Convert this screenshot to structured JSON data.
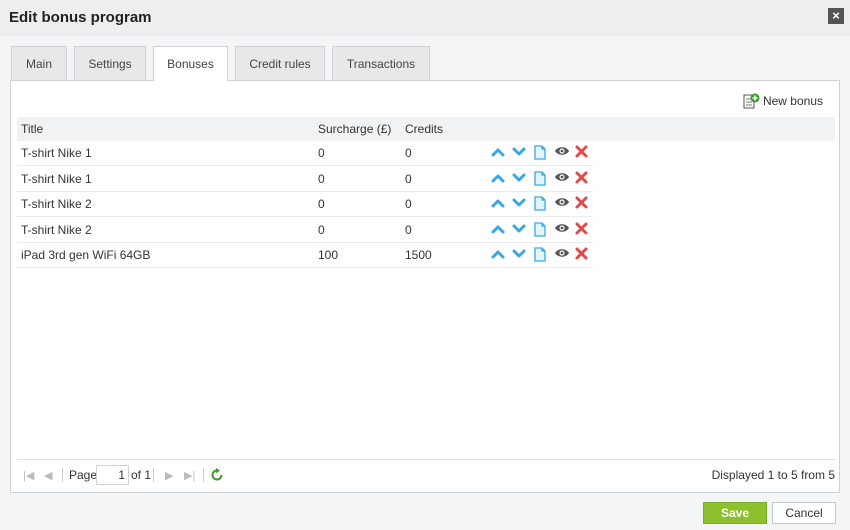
{
  "dialog": {
    "title": "Edit bonus program",
    "close_label": "×"
  },
  "tabs": [
    {
      "label": "Main"
    },
    {
      "label": "Settings"
    },
    {
      "label": "Bonuses",
      "active": true
    },
    {
      "label": "Credit rules"
    },
    {
      "label": "Transactions"
    }
  ],
  "toolbar": {
    "new_bonus_label": "New bonus"
  },
  "grid": {
    "columns": {
      "title": "Title",
      "surcharge": "Surcharge (£)",
      "credits": "Credits"
    },
    "rows": [
      {
        "title": "T-shirt Nike 1",
        "surcharge": "0",
        "credits": "0"
      },
      {
        "title": "T-shirt Nike 1",
        "surcharge": "0",
        "credits": "0"
      },
      {
        "title": "T-shirt Nike 2",
        "surcharge": "0",
        "credits": "0"
      },
      {
        "title": "T-shirt Nike 2",
        "surcharge": "0",
        "credits": "0"
      },
      {
        "title": "iPad 3rd gen WiFi 64GB",
        "surcharge": "100",
        "credits": "1500"
      }
    ],
    "row_action_icons": [
      "move-up-icon",
      "move-down-icon",
      "copy-icon",
      "view-icon",
      "delete-icon"
    ]
  },
  "pager": {
    "page_label": "Page",
    "current_page": "1",
    "of_label": "of 1",
    "displayed_text": "Displayed 1 to 5 from 5"
  },
  "footer": {
    "save_label": "Save",
    "cancel_label": "Cancel"
  },
  "colors": {
    "accent_blue": "#3aa6e6",
    "delete_red": "#e04a4a",
    "save_green": "#8cc02d",
    "refresh_green": "#3a9a2a"
  }
}
